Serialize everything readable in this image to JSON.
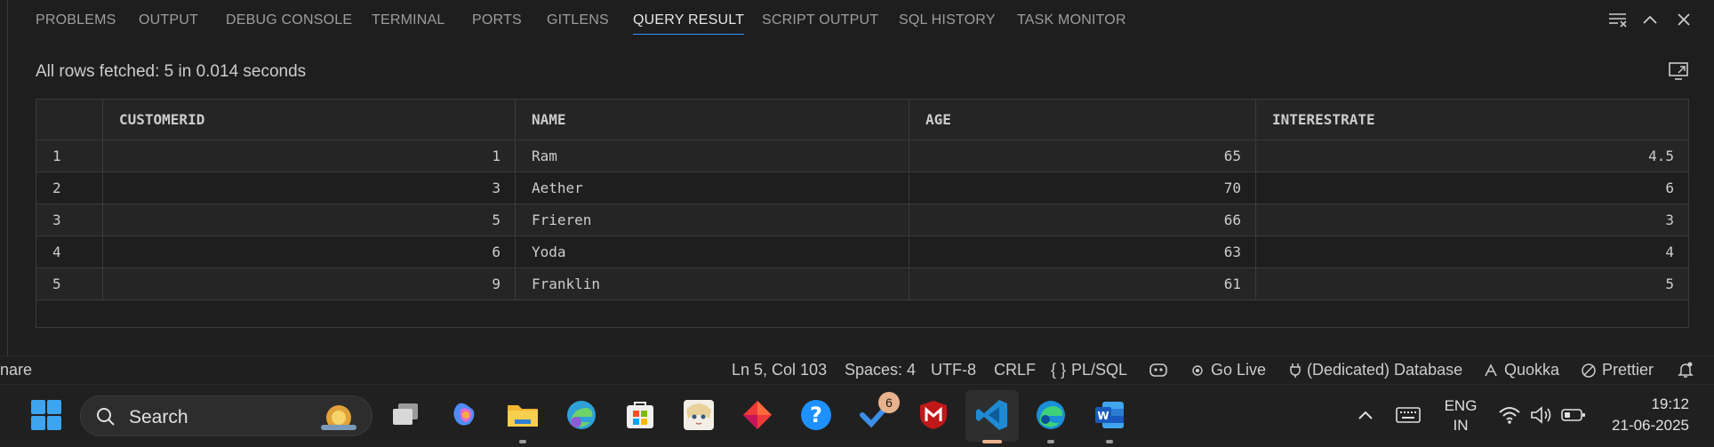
{
  "panel": {
    "tabs": [
      "PROBLEMS",
      "OUTPUT",
      "DEBUG CONSOLE",
      "TERMINAL",
      "PORTS",
      "GITLENS",
      "QUERY RESULT",
      "SCRIPT OUTPUT",
      "SQL HISTORY",
      "TASK MONITOR"
    ],
    "active_tab": "QUERY RESULT",
    "status_message": "All rows fetched: 5 in 0.014 seconds",
    "accent": "#3794ff"
  },
  "table": {
    "columns": [
      "",
      "CUSTOMERID",
      "NAME",
      "AGE",
      "INTERESTRATE"
    ],
    "rows": [
      [
        "1",
        "1",
        "Ram",
        "65",
        "4.5"
      ],
      [
        "2",
        "3",
        "Aether",
        "70",
        "6"
      ],
      [
        "3",
        "5",
        "Frieren",
        "66",
        "3"
      ],
      [
        "4",
        "6",
        "Yoda",
        "63",
        "4"
      ],
      [
        "5",
        "9",
        "Franklin",
        "61",
        "5"
      ]
    ]
  },
  "statusbar": {
    "left_fragment": "nare",
    "position": "Ln 5, Col 103",
    "spaces": "Spaces: 4",
    "encoding": "UTF-8",
    "eol": "CRLF",
    "language": "PL/SQL",
    "go_live": "Go Live",
    "database": "(Dedicated) Database",
    "quokka": "Quokka",
    "prettier": "Prettier"
  },
  "taskbar": {
    "search_label": "Search",
    "todo_badge": "6",
    "language": "ENG",
    "region": "IN",
    "time": "19:12",
    "date": "21-06-2025",
    "icons": [
      "start-icon",
      "task-view-icon",
      "copilot-icon",
      "file-explorer-icon",
      "edge-beta-icon",
      "ms-store-icon",
      "anime-app-icon",
      "red-diamond-app-icon",
      "help-icon",
      "todo-icon",
      "mcafee-icon",
      "vscode-icon",
      "edge-icon",
      "word-icon"
    ]
  }
}
